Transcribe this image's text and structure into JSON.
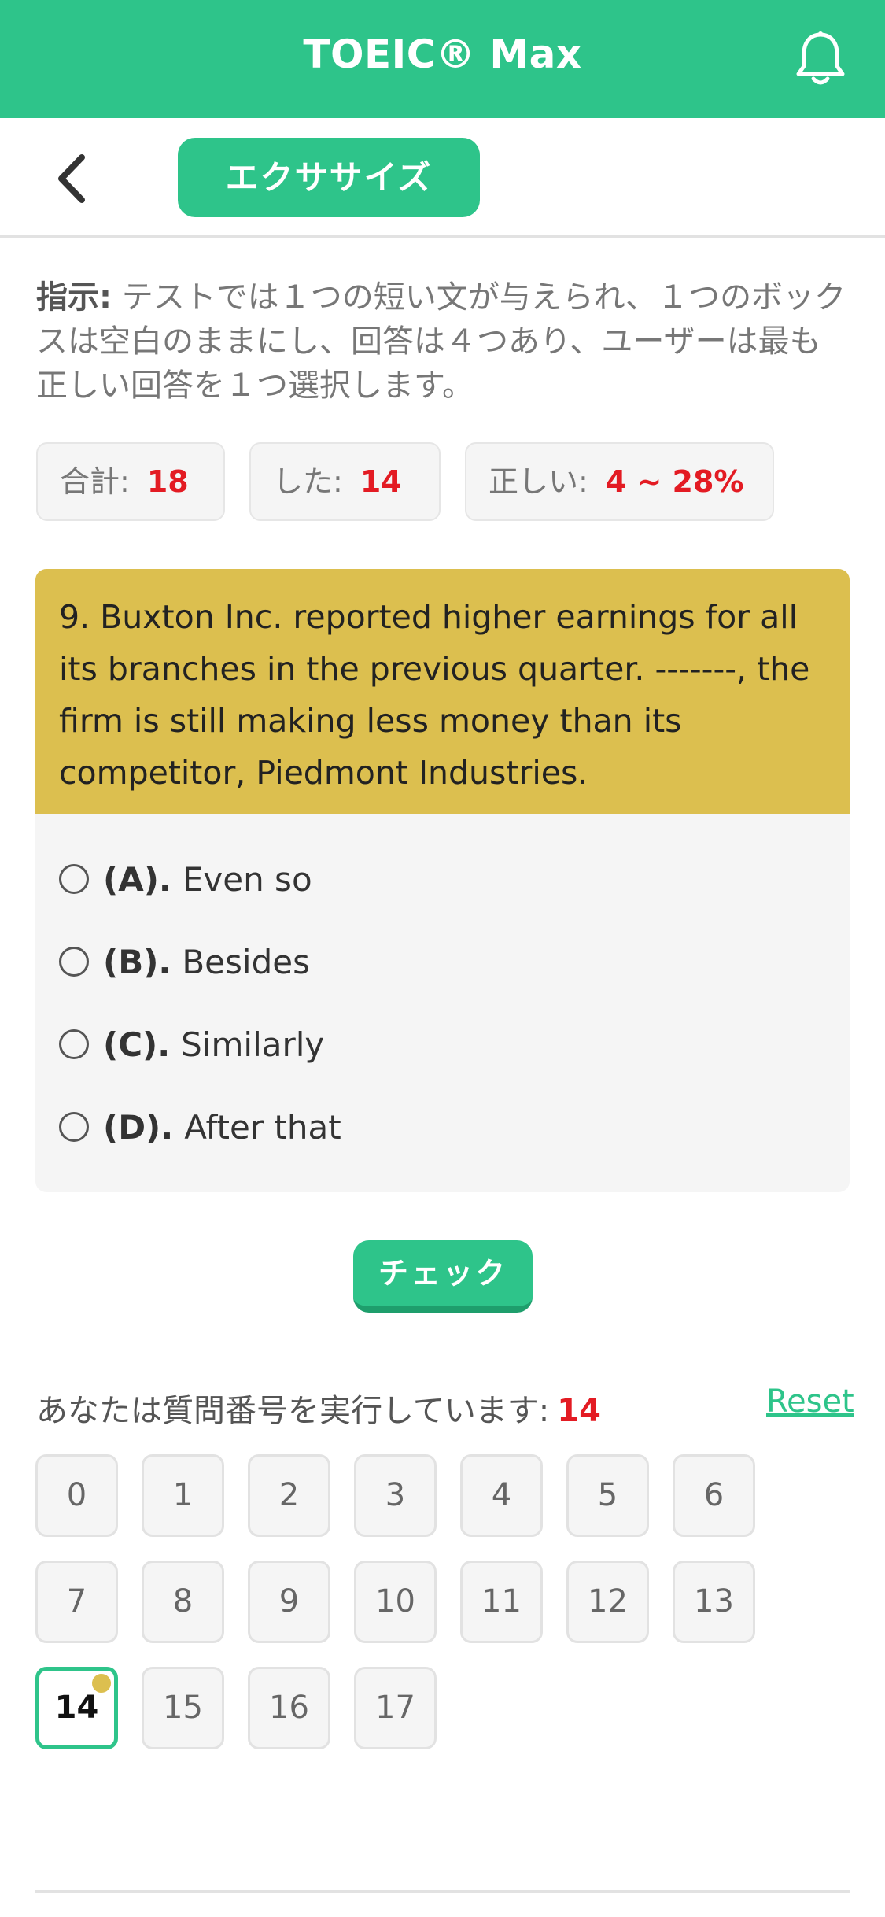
{
  "header": {
    "title": "TOEIC® Max",
    "bell_icon": "bell-icon"
  },
  "subbar": {
    "back_icon": "chevron-left-icon",
    "tab_label": "エクササイズ"
  },
  "instructions": {
    "label": "指示:",
    "text": " テストでは１つの短い文が与えられ、１つのボックスは空白のままにし、回答は４つあり、ユーザーは最も正しい回答を１つ選択します。"
  },
  "stats": {
    "total_label": "合計:",
    "total_value": "18",
    "done_label": "した:",
    "done_value": "14",
    "correct_label": "正しい:",
    "correct_value": "4 ~ 28%"
  },
  "question": {
    "text": "9. Buxton Inc. reported higher earnings for all its branches in the previous quarter. -------, the firm is still making less money than its competitor, Piedmont Industries.",
    "options": [
      {
        "letter": "(A).",
        "text": "Even so"
      },
      {
        "letter": "(B).",
        "text": "Besides"
      },
      {
        "letter": "(C).",
        "text": "Similarly"
      },
      {
        "letter": "(D).",
        "text": "After that"
      }
    ]
  },
  "check_button": "チェック",
  "progress": {
    "label": "あなたは質問番号を実行しています:",
    "current": "14",
    "reset": "Reset"
  },
  "question_numbers": [
    "0",
    "1",
    "2",
    "3",
    "4",
    "5",
    "6",
    "7",
    "8",
    "9",
    "10",
    "11",
    "12",
    "13",
    "14",
    "15",
    "16",
    "17"
  ],
  "colors": {
    "accent": "#2ec48a",
    "question_bg": "#dcbf4f",
    "highlight": "#e31b23"
  }
}
